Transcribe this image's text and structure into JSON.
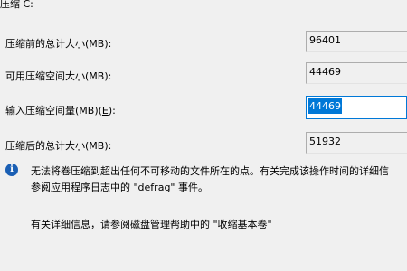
{
  "dialog": {
    "title": "压缩 C:",
    "rows": [
      {
        "label": "压缩前的总计大小(MB):",
        "value": "96401"
      },
      {
        "label": "可用压缩空间大小(MB):",
        "value": "44469"
      },
      {
        "label_prefix": "输入压缩空间量(MB)(",
        "label_mnemonic": "E",
        "label_suffix": "):",
        "value": "44469"
      },
      {
        "label": "压缩后的总计大小(MB):",
        "value": "51932"
      }
    ],
    "info": {
      "line1": "无法将卷压缩到超出任何不可移动的文件所在的点。有关完成该操作时间的详细信",
      "line2": "参阅应用程序日志中的 \"defrag\" 事件。"
    },
    "help": "有关详细信息，请参阅磁盘管理帮助中的 \"收缩基本卷\""
  }
}
